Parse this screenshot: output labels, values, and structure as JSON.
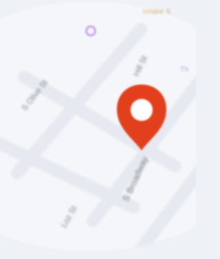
{
  "map": {
    "streets": {
      "s_olive": "S Olive St",
      "s_hill": "Hill St",
      "s_broadway": "S Broadway",
      "lower_left": "Loz St"
    },
    "pois": {
      "top_right_label": "Intake S",
      "side_label": "Th"
    },
    "colors": {
      "background": "#eef1f5",
      "map_fill": "#f4f6f9",
      "road": "#e6e9ef",
      "pin": "#e2401d",
      "pin_center": "#ffffff",
      "poi_purple": "#c7a7f0",
      "label_orange": "#e0b07a"
    },
    "icons": {
      "pin": "map-pin-icon",
      "poi": "poi-dot-icon"
    }
  }
}
